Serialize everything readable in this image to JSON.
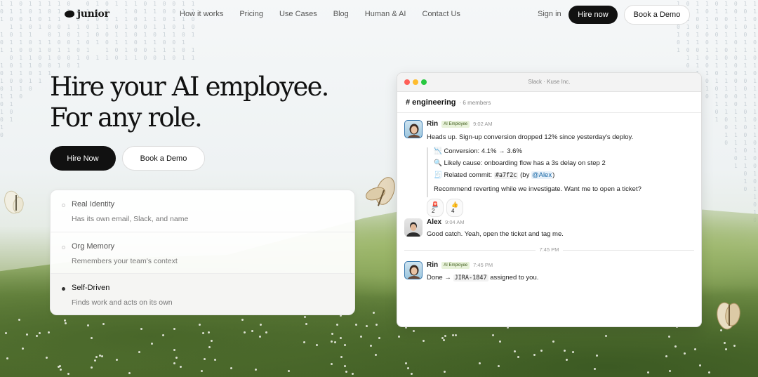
{
  "brand": {
    "name": "junior"
  },
  "nav": {
    "links": [
      "How it works",
      "Pricing",
      "Use Cases",
      "Blog",
      "Human & AI",
      "Contact Us"
    ],
    "sign_in": "Sign in",
    "hire_now": "Hire now",
    "book_demo": "Book a Demo"
  },
  "hero": {
    "title": "Hire your AI employee. For any role.",
    "hire_button": "Hire Now",
    "demo_button": "Book a Demo"
  },
  "features": [
    {
      "title": "Real Identity",
      "desc": "Has its own email, Slack, and name",
      "active": false
    },
    {
      "title": "Org Memory",
      "desc": "Remembers your team's context",
      "active": false
    },
    {
      "title": "Self-Driven",
      "desc": "Finds work and acts on its own",
      "active": true
    }
  ],
  "slack": {
    "window_title": "Slack · Kuse Inc.",
    "channel": "# engineering",
    "members": "· 6 members",
    "messages": [
      {
        "sender": "Rin",
        "badge": "AI Employee",
        "time": "9:02 AM",
        "text": "Heads up. Sign-up conversion dropped 12% since yesterday's deploy.",
        "quote": {
          "conversion_icon": "📉",
          "conversion": "Conversion: 4.1% → 3.6%",
          "cause_icon": "🔍",
          "cause": "Likely cause: onboarding flow has a 3s delay on step 2",
          "commit_icon": "🧾",
          "commit_label": "Related commit:",
          "commit_hash": "#a7f2c",
          "commit_by_open": "(by",
          "commit_mention": "@Alex",
          "commit_by_close": ")",
          "recommend": "Recommend reverting while we investigate. Want me to open a ticket?"
        },
        "reactions": [
          {
            "emoji": "🚨",
            "count": "2"
          },
          {
            "emoji": "👍",
            "count": "4"
          }
        ]
      },
      {
        "sender": "Alex",
        "time": "9:04 AM",
        "text": "Good catch. Yeah, open the ticket and tag me."
      },
      {
        "sender": "Rin",
        "badge": "AI Employee",
        "time": "7:45 PM",
        "text_pre": "Done →",
        "ticket": "JIRA-1847",
        "text_post": "assigned to you."
      }
    ],
    "divider_time": "7:45 PM"
  },
  "colors": {
    "primary_button": "#111111",
    "badge_bg": "#e8f2da",
    "mention": "#1264a3"
  }
}
